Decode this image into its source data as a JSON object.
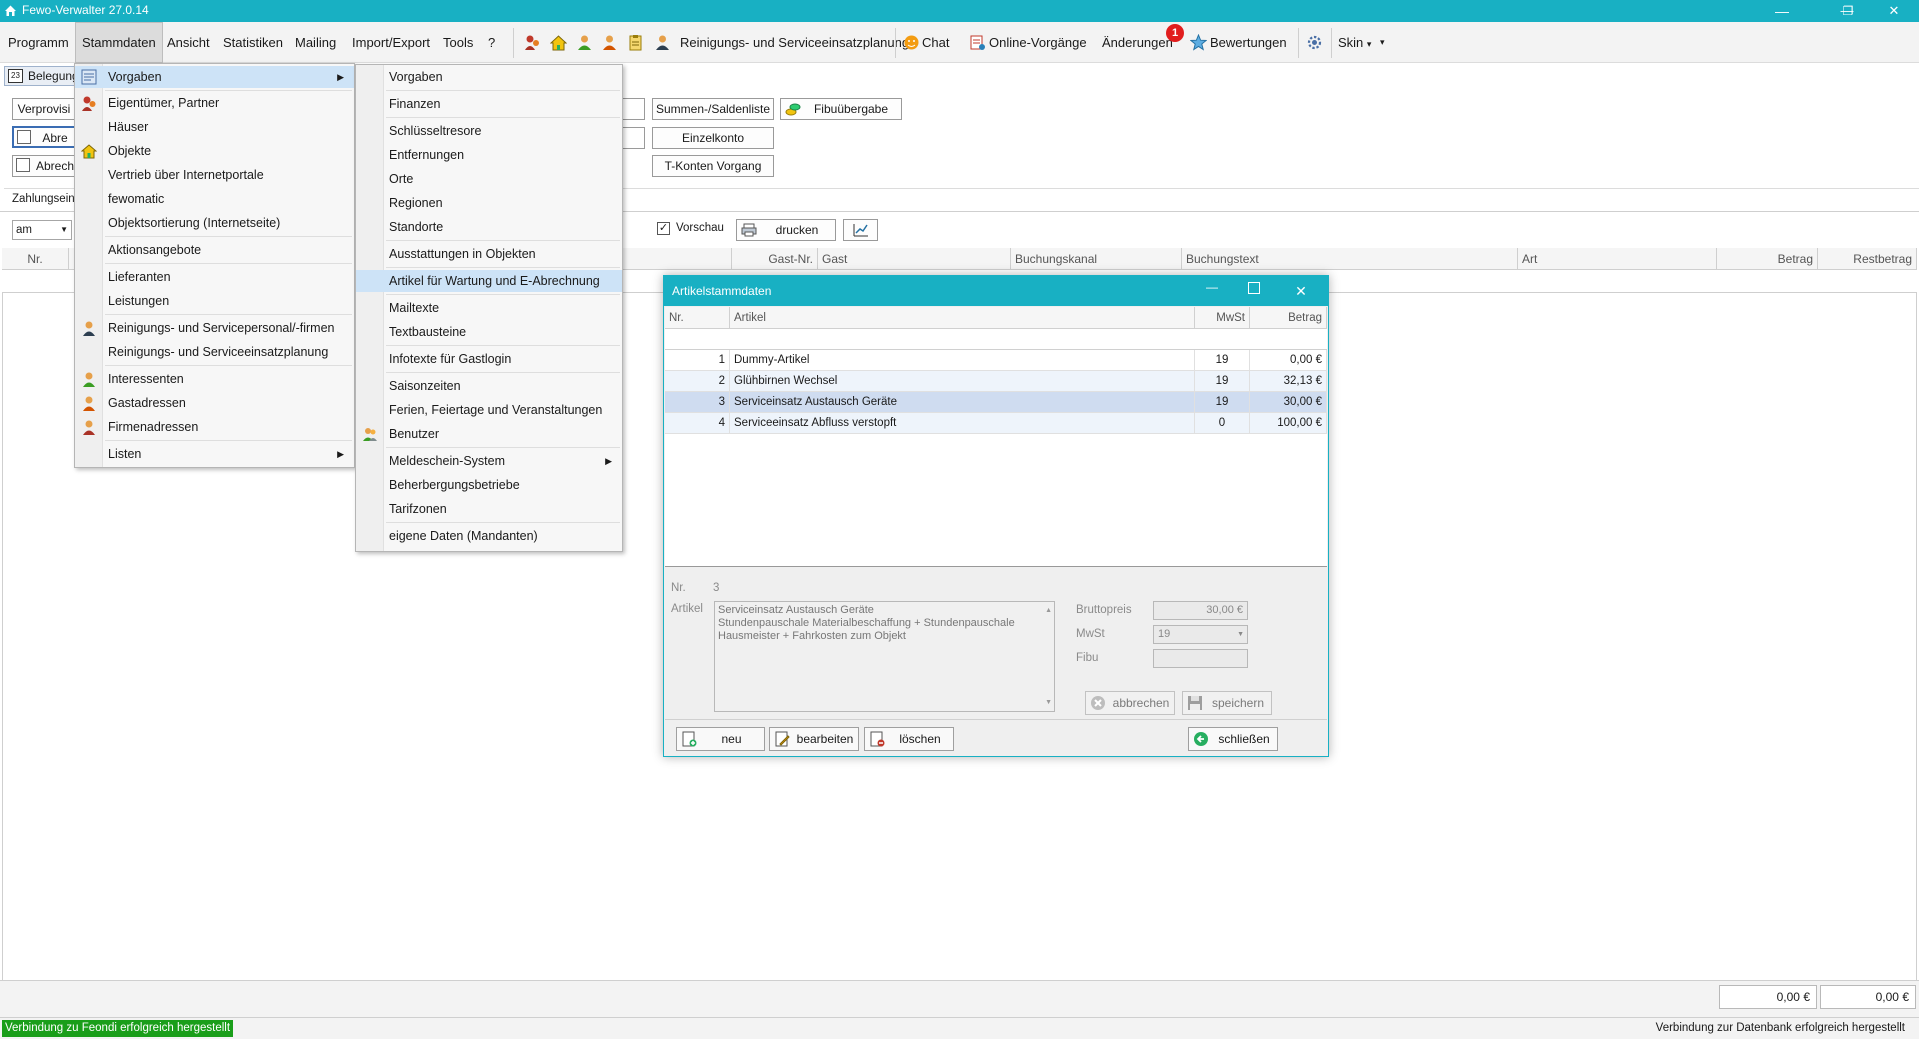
{
  "window": {
    "title": "Fewo-Verwalter 27.0.14",
    "minimize": "—",
    "restore": "❐",
    "close": "✕"
  },
  "menubar": {
    "items": [
      "Programm",
      "Stammdaten",
      "Ansicht",
      "Statistiken",
      "Mailing",
      "Import/Export",
      "Tools",
      "?"
    ],
    "toolbar_cleaning_label": "Reinigungs- und Serviceeinsatzplanung",
    "chat_label": "Chat",
    "online_label": "Online-Vorgänge",
    "changes_label": "Änderungen",
    "changes_badge": "1",
    "ratings_label": "Bewertungen",
    "skin_label": "Skin",
    "skin_arrow": "▾",
    "more_arrow": "▾"
  },
  "main": {
    "tab_belegung": "Belegung",
    "calendar_icon_text": "23",
    "btn_verprovision": "Verprovisi",
    "btn_abre": "Abre",
    "btn_abrech": "Abrech",
    "zahlungsein_label": "Zahlungsein-",
    "am_value": "am",
    "btn_summen": "Summen-/Saldenliste",
    "btn_fibu": "Fibuübergabe",
    "btn_einzelkonto": "Einzelkonto",
    "btn_tkonten": "T-Konten Vorgang",
    "vorschau_label": "Vorschau",
    "print_label": "drucken",
    "grid_headers": [
      "Nr.",
      "Gast-Nr.",
      "Gast",
      "Buchungskanal",
      "Buchungstext",
      "Art",
      "Betrag",
      "Restbetrag"
    ],
    "total_betrag": "0,00 €",
    "total_rest": "0,00 €"
  },
  "stammdaten_menu": {
    "items": [
      "Vorgaben",
      "Eigentümer, Partner",
      "Häuser",
      "Objekte",
      "Vertrieb über Internetportale",
      "fewomatic",
      "Objektsortierung (Internetseite)",
      "Aktionsangebote",
      "Lieferanten",
      "Leistungen",
      "Reinigungs- und Servicepersonal/-firmen",
      "Reinigungs- und Serviceeinsatzplanung",
      "Interessenten",
      "Gastadressen",
      "Firmenadressen",
      "Listen"
    ],
    "submenu_arrow": "▶"
  },
  "vorgaben_menu": {
    "items": [
      "Vorgaben",
      "Finanzen",
      "Schlüsseltresore",
      "Entfernungen",
      "Orte",
      "Regionen",
      "Standorte",
      "Ausstattungen in Objekten",
      "Artikel für Wartung und E-Abrechnung",
      "Mailtexte",
      "Textbausteine",
      "Infotexte für Gastlogin",
      "Saisonzeiten",
      "Ferien, Feiertage und Veranstaltungen",
      "Benutzer",
      "Meldeschein-System",
      "Beherbergungsbetriebe",
      "Tarifzonen",
      "eigene Daten (Mandanten)"
    ]
  },
  "dialog": {
    "title": "Artikelstammdaten",
    "columns": [
      "Nr.",
      "Artikel",
      "MwSt",
      "Betrag"
    ],
    "rows": [
      {
        "nr": "1",
        "artikel": "Dummy-Artikel",
        "mwst": "19",
        "betrag": "0,00 €"
      },
      {
        "nr": "2",
        "artikel": "Glühbirnen Wechsel",
        "mwst": "19",
        "betrag": "32,13 €"
      },
      {
        "nr": "3",
        "artikel": "Serviceinsatz Austausch Geräte",
        "mwst": "19",
        "betrag": "30,00 €"
      },
      {
        "nr": "4",
        "artikel": "Serviceeinsatz Abfluss verstopft",
        "mwst": "0",
        "betrag": "100,00 €"
      }
    ],
    "detail": {
      "nr_label": "Nr.",
      "nr_value": "3",
      "artikel_label": "Artikel",
      "artikel_lines": [
        "Serviceinsatz Austausch Geräte",
        "Stundenpauschale Materialbeschaffung + Stundenpauschale",
        "Hausmeister + Fahrkosten zum Objekt"
      ],
      "brutto_label": "Bruttopreis",
      "brutto_value": "30,00 €",
      "mwst_label": "MwSt",
      "mwst_value": "19",
      "fibu_label": "Fibu",
      "fibu_value": ""
    },
    "buttons": {
      "abbrechen": "abbrechen",
      "speichern": "speichern",
      "neu": "neu",
      "bearbeiten": "bearbeiten",
      "loeschen": "löschen",
      "schliessen": "schließen"
    }
  },
  "statusbar": {
    "left": "Verbindung zu Feondi erfolgreich hergestellt",
    "right": "Verbindung zur Datenbank erfolgreich hergestellt"
  },
  "colors": {
    "accent": "#18b0c3",
    "menu_highlight": "#cde3f7",
    "status_green": "#1a9e1a",
    "badge_red": "#e11d1d"
  }
}
